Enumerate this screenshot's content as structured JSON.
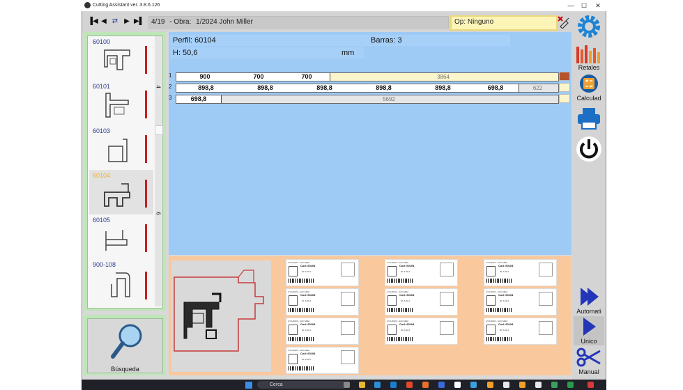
{
  "window": {
    "title": "Cutting Assistant ver. 3.8.6.126",
    "controls": [
      "—",
      "☐",
      "✕"
    ]
  },
  "toolbar": {
    "nav_icons": [
      "first-icon",
      "prev-icon",
      "swap-icon",
      "next-icon",
      "last-icon"
    ],
    "position": "4/19",
    "obra_label": "- Obra:",
    "obra_value": "1/2024 John Miller",
    "operator": "Op: Ninguno"
  },
  "profiles": [
    {
      "id": "60100",
      "selected": false
    },
    {
      "id": "60101",
      "selected": false
    },
    {
      "id": "60103",
      "selected": false
    },
    {
      "id": "60104",
      "selected": true
    },
    {
      "id": "60105",
      "selected": false
    },
    {
      "id": "900-108",
      "selected": false
    }
  ],
  "list_side_numbers": [
    "4",
    "6"
  ],
  "search": {
    "label": "Búsqueda"
  },
  "main": {
    "perfil": "Perfil: 60104",
    "barras": "Barras: 3",
    "h": "H: 50,6",
    "unit": "mm"
  },
  "bars": [
    {
      "num": "1",
      "cuts": [
        "900",
        "700",
        "700"
      ],
      "remainder": "3864",
      "swatch": "#b5532c",
      "rest_color": "#fbf5cc"
    },
    {
      "num": "2",
      "cuts": [
        "898,8",
        "898,8",
        "898,8",
        "898,8",
        "898,8",
        "698,8"
      ],
      "remainder": "622",
      "swatch": "#fbf5cc",
      "rest_color": "#e6e6e6"
    },
    {
      "num": "3",
      "cuts": [
        "698,8"
      ],
      "remainder": "5692",
      "swatch": "#fbf5cc",
      "rest_color": "#e6e6e6"
    }
  ],
  "labels": {
    "header": "1/1   1/2024 - John Miller",
    "code": "Cod: 60104",
    "sub": "ID: A.01.0",
    "count": 10
  },
  "tools": [
    {
      "name": "settings",
      "label": ""
    },
    {
      "name": "retales",
      "label": "Retales"
    },
    {
      "name": "calculadora",
      "label": "Calculad"
    },
    {
      "name": "print",
      "label": ""
    },
    {
      "name": "power",
      "label": ""
    },
    {
      "name": "automatic",
      "label": "Automati"
    },
    {
      "name": "unico",
      "label": "Unico"
    },
    {
      "name": "manual",
      "label": "Manual"
    }
  ],
  "taskbar": {
    "search_placeholder": "Cerca"
  }
}
